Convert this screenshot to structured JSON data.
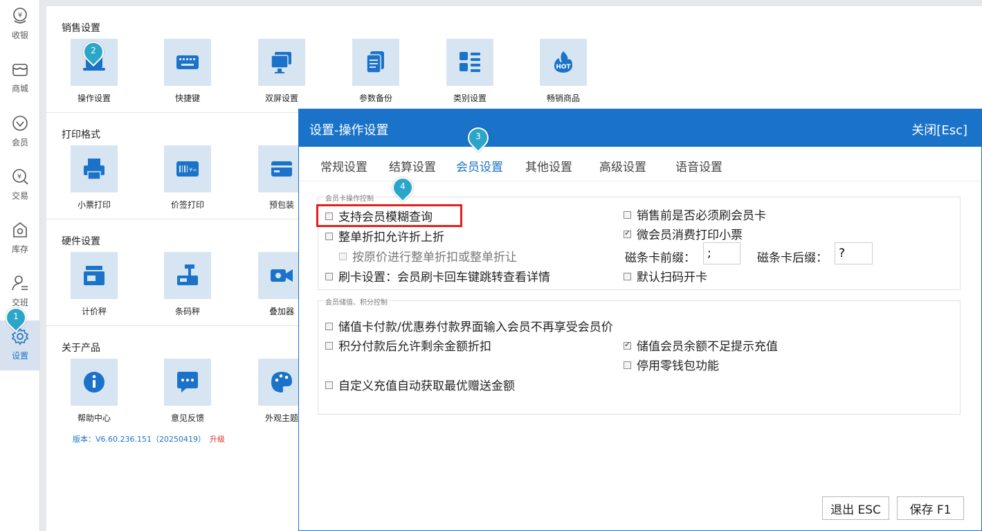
{
  "sidebar": {
    "items": [
      {
        "label": "收银",
        "icon": "cash-register-icon"
      },
      {
        "label": "商城",
        "icon": "shop-icon"
      },
      {
        "label": "会员",
        "icon": "member-diamond-icon"
      },
      {
        "label": "交易",
        "icon": "transaction-yen-icon"
      },
      {
        "label": "库存",
        "icon": "inventory-icon"
      },
      {
        "label": "交班",
        "icon": "shift-handover-icon"
      },
      {
        "label": "设置",
        "icon": "gear-icon"
      }
    ],
    "active": "设置"
  },
  "sections": {
    "sales": {
      "title": "销售设置",
      "tiles": [
        "操作设置",
        "快捷键",
        "双屏设置",
        "参数备份",
        "类别设置",
        "畅销商品"
      ]
    },
    "print": {
      "title": "打印格式",
      "tiles": [
        "小票打印",
        "价签打印",
        "预包装"
      ]
    },
    "hardware": {
      "title": "硬件设置",
      "tiles": [
        "计价秤",
        "条码秤",
        "叠加器"
      ]
    },
    "about": {
      "title": "关于产品",
      "tiles": [
        "帮助中心",
        "意见反馈",
        "外观主题"
      ],
      "version": "版本：V6.60.236.151（20250419）",
      "upgrade": "升级"
    }
  },
  "dialog": {
    "title": "设置-操作设置",
    "close": "关闭[Esc]",
    "tabs": [
      "常规设置",
      "结算设置",
      "会员设置",
      "其他设置",
      "高级设置",
      "语音设置"
    ],
    "active_tab": "会员设置",
    "group1": {
      "title": "会员卡操作控制",
      "left": [
        {
          "label": "支持会员模糊查询",
          "checked": false
        },
        {
          "label": "整单折扣允许折上折",
          "checked": false
        },
        {
          "label": "按原价进行整单折扣或整单折让",
          "checked": false
        },
        {
          "label": "刷卡设置：会员刷卡回车键跳转查看详情",
          "checked": false
        }
      ],
      "right": [
        {
          "label": "销售前是否必须刷会员卡",
          "checked": false
        },
        {
          "label": "微会员消费打印小票",
          "checked": true
        },
        {
          "label": "默认扫码开卡",
          "checked": false
        }
      ],
      "prefix_label": "磁条卡前缀：",
      "prefix_value": ";",
      "suffix_label": "磁条卡后缀：",
      "suffix_value": "?"
    },
    "group2": {
      "title": "会员储值、积分控制",
      "left": [
        {
          "label": "储值卡付款/优惠券付款界面输入会员不再享受会员价",
          "checked": false
        },
        {
          "label": "积分付款后允许剩余金额折扣",
          "checked": false
        },
        {
          "label": "自定义充值自动获取最优赠送金额",
          "checked": false
        }
      ],
      "right": [
        {
          "label": "储值会员余额不足提示充值",
          "checked": true
        },
        {
          "label": "停用零钱包功能",
          "checked": false
        }
      ]
    },
    "buttons": {
      "exit": "退出 ESC",
      "save": "保存 F1"
    }
  },
  "markers": [
    "1",
    "2",
    "3",
    "4"
  ],
  "colors": {
    "accent": "#1a73c9",
    "tile_bg": "#d7e5f3",
    "highlight": "#e31e1e",
    "marker": "#2ba6c9"
  }
}
